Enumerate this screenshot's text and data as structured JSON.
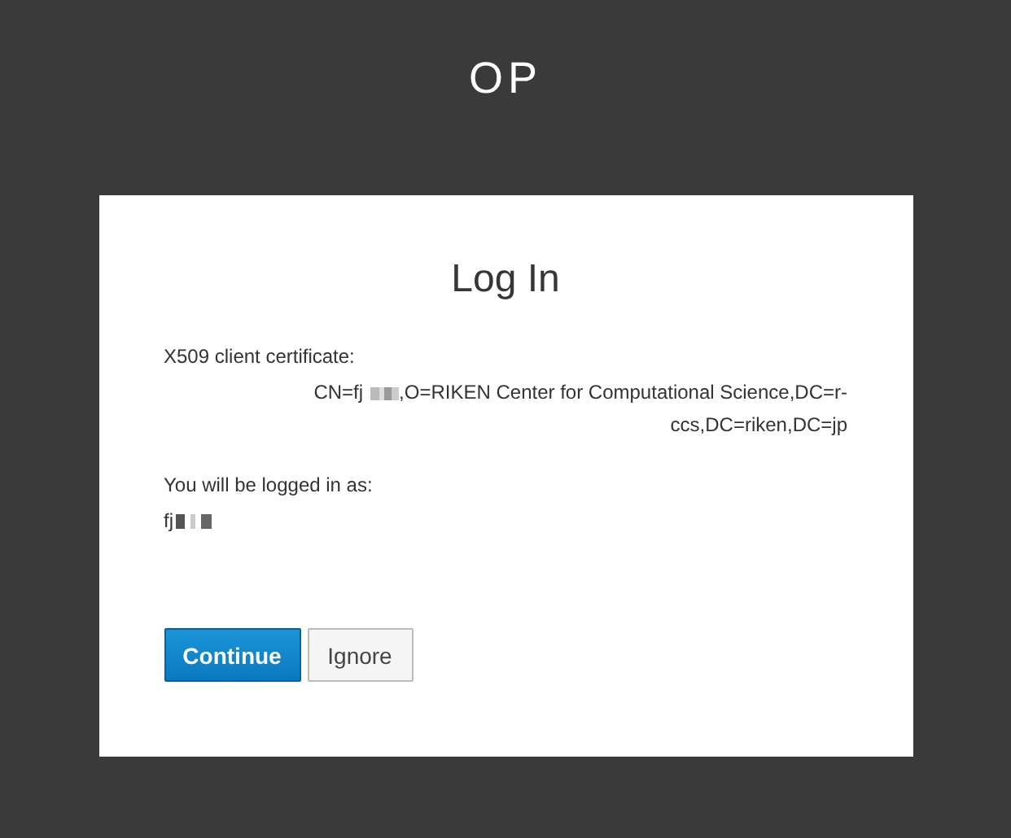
{
  "header": {
    "title": "OP"
  },
  "card": {
    "title": "Log In",
    "certificate_label": "X509 client certificate:",
    "certificate_parts": [
      "CN=fj",
      ",O=RIKEN Center for Computational Science,DC=r-ccs,DC=riken,DC=jp"
    ],
    "user_label": "You will be logged in as:",
    "user_value": "fj",
    "buttons": [
      {
        "label": "Continue",
        "kind": "primary"
      },
      {
        "label": "Ignore",
        "kind": "default"
      }
    ]
  }
}
